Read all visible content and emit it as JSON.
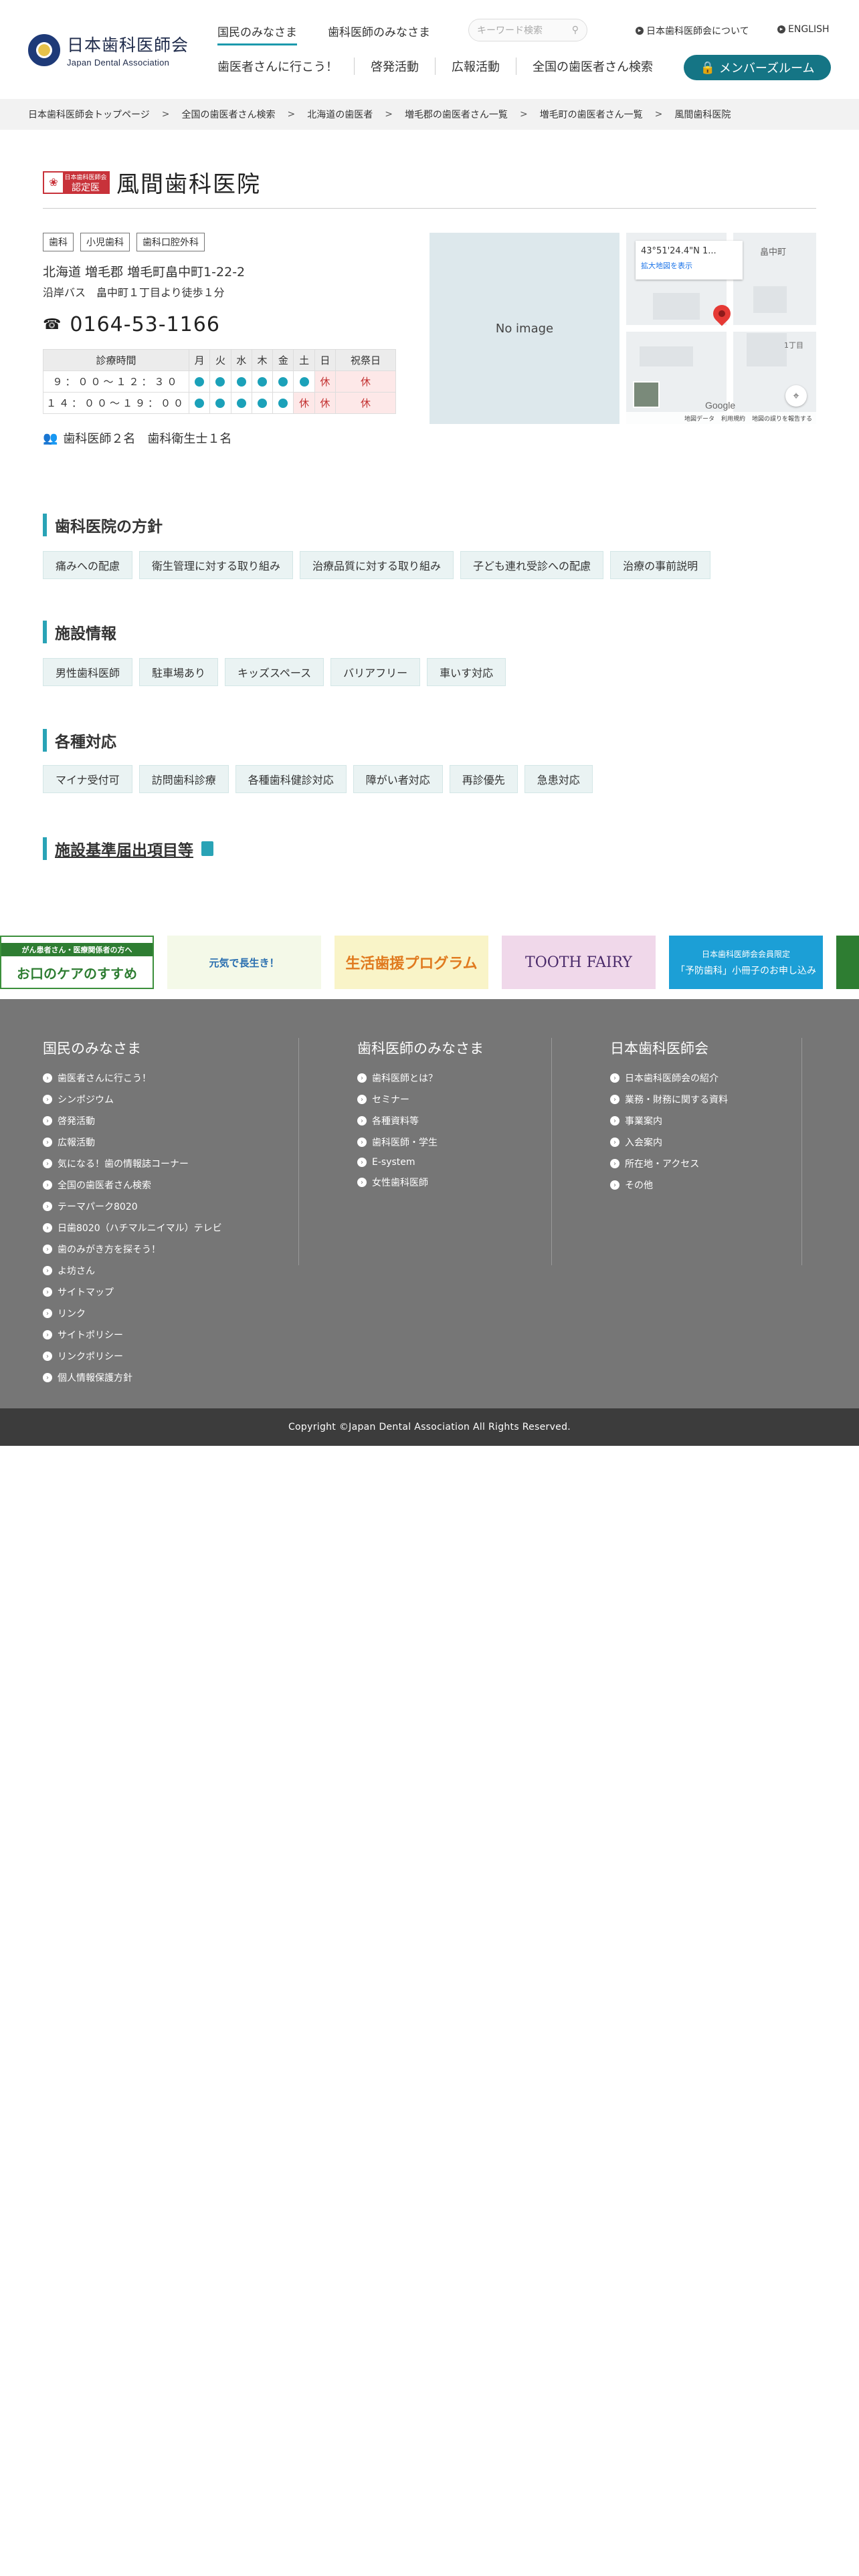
{
  "header": {
    "logo_ja": "日本歯科医師会",
    "logo_en": "Japan Dental Association",
    "nav_top": [
      "国民のみなさま",
      "歯科医師のみなさま"
    ],
    "search_placeholder": "キーワード検索",
    "about_link": "日本歯科医師会について",
    "english_link": "ENGLISH",
    "nav_bottom": [
      "歯医者さんに行こう！",
      "啓発活動",
      "広報活動",
      "全国の歯医者さん検索"
    ],
    "member_button": "メンバーズルーム"
  },
  "breadcrumb": [
    "日本歯科医師会トップページ",
    "全国の歯医者さん検索",
    "北海道の歯医者",
    "増毛郡の歯医者さん一覧",
    "増毛町の歯医者さん一覧",
    "風間歯科医院"
  ],
  "clinic": {
    "cert_small": "日本歯科医師会",
    "cert_label": "認定医",
    "name": "風間歯科医院",
    "tags": [
      "歯科",
      "小児歯科",
      "歯科口腔外科"
    ],
    "address": "北海道 増毛郡 増毛町畠中町1-22-2",
    "access": "沿岸バス　畠中町１丁目より徒歩１分",
    "phone": "0164-53-1166",
    "hours_headers": [
      "診療時間",
      "月",
      "火",
      "水",
      "木",
      "金",
      "土",
      "日",
      "祝祭日"
    ],
    "hours_rows": [
      {
        "time": "９：００～１２：３０",
        "days": [
          "open",
          "open",
          "open",
          "open",
          "open",
          "open",
          "休",
          "休"
        ]
      },
      {
        "time": "１４：００～１９：００",
        "days": [
          "open",
          "open",
          "open",
          "open",
          "open",
          "休",
          "休",
          "休"
        ]
      }
    ],
    "staff": "歯科医師２名　歯科衛生士１名",
    "no_image": "No image"
  },
  "map": {
    "coords": "43°51'24.4\"N 1...",
    "enlarge": "拡大地図を表示",
    "label_area": "畠中町",
    "label_street": "1丁目",
    "google": "Google",
    "footer_items": [
      "地図データ",
      "利用規約",
      "地図の誤りを報告する"
    ]
  },
  "sections": {
    "policy": {
      "title": "歯科医院の方針",
      "items": [
        "痛みへの配慮",
        "衛生管理に対する取り組み",
        "治療品質に対する取り組み",
        "子ども連れ受診への配慮",
        "治療の事前説明"
      ]
    },
    "facility": {
      "title": "施設情報",
      "items": [
        "男性歯科医師",
        "駐車場あり",
        "キッズスペース",
        "バリアフリー",
        "車いす対応"
      ]
    },
    "support": {
      "title": "各種対応",
      "items": [
        "マイナ受付可",
        "訪問歯科診療",
        "各種歯科健診対応",
        "障がい者対応",
        "再診優先",
        "急患対応"
      ]
    },
    "standards": {
      "title": "施設基準届出項目等"
    }
  },
  "banners": [
    {
      "top": "がん患者さん・医療関係者の方へ",
      "main": "お口のケアのすすめ"
    },
    {
      "main": "元気で長生き！"
    },
    {
      "main": "生活歯援プログラム"
    },
    {
      "main": "TOOTH FAIRY"
    },
    {
      "top": "日本歯科医師会会員限定",
      "main": "「予防歯科」小冊子のお申し込み"
    }
  ],
  "footer": {
    "col1_title": "国民のみなさま",
    "col1_items": [
      "歯医者さんに行こう！",
      "シンポジウム",
      "啓発活動",
      "広報活動",
      "気になる！歯の情報誌コーナー",
      "全国の歯医者さん検索",
      "テーマパーク8020",
      "日歯8020（ハチマルニイマル）テレビ",
      "歯のみがき方を探そう！",
      "よ坊さん",
      "サイトマップ",
      "リンク",
      "サイトポリシー",
      "リンクポリシー",
      "個人情報保護方針"
    ],
    "col2_title": "歯科医師のみなさま",
    "col2_items": [
      "歯科医師とは？",
      "セミナー",
      "各種資料等",
      "歯科医師・学生",
      "E-system",
      "女性歯科医師"
    ],
    "col3_title": "日本歯科医師会",
    "col3_items": [
      "日本歯科医師会の紹介",
      "業務・財務に関する資料",
      "事業案内",
      "入会案内",
      "所在地・アクセス",
      "その他"
    ],
    "copyright": "Copyright ©Japan Dental Association All Rights Reserved."
  },
  "colors": {
    "accent": "#29a3b6",
    "member_button": "#157585",
    "closed_bg": "#fde8e8",
    "footer_bg": "#767676"
  }
}
